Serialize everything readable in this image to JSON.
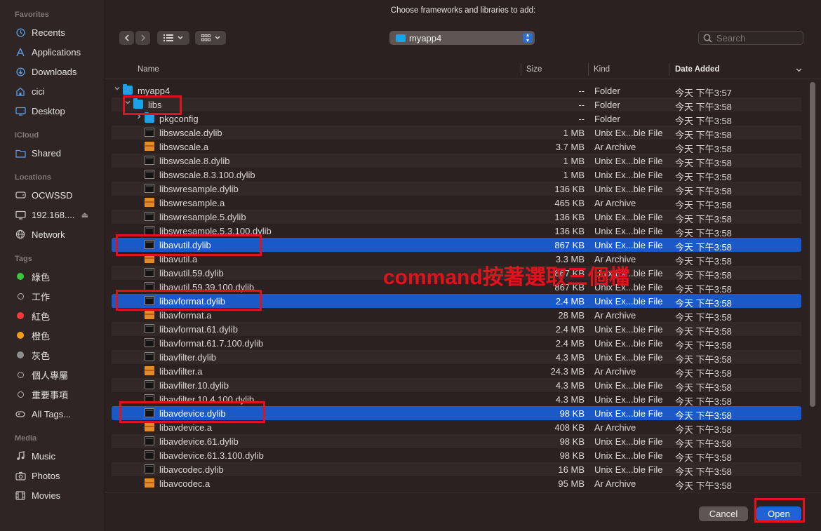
{
  "dialog_title": "Choose frameworks and libraries to add:",
  "sidebar": {
    "sections": [
      {
        "label": "Favorites",
        "items": [
          {
            "label": "Recents",
            "icon": "clock-icon"
          },
          {
            "label": "Applications",
            "icon": "applications-icon"
          },
          {
            "label": "Downloads",
            "icon": "download-icon"
          },
          {
            "label": "cici",
            "icon": "home-icon"
          },
          {
            "label": "Desktop",
            "icon": "desktop-icon"
          }
        ]
      },
      {
        "label": "iCloud",
        "items": [
          {
            "label": "Shared",
            "icon": "shared-folder-icon"
          }
        ]
      },
      {
        "label": "Locations",
        "items": [
          {
            "label": "OCWSSD",
            "icon": "drive-icon"
          },
          {
            "label": "192.168....",
            "icon": "display-icon"
          },
          {
            "label": "Network",
            "icon": "globe-icon"
          }
        ]
      },
      {
        "label": "Tags",
        "items": [
          {
            "label": "綠色",
            "color": "#3ac53f"
          },
          {
            "label": "工作",
            "color": ""
          },
          {
            "label": "紅色",
            "color": "#f23b3a"
          },
          {
            "label": "橙色",
            "color": "#f59d1b"
          },
          {
            "label": "灰色",
            "color": "#8e8e8e"
          },
          {
            "label": "個人專屬",
            "color": ""
          },
          {
            "label": "重要事項",
            "color": ""
          },
          {
            "label": "All Tags...",
            "icon": "tags-icon"
          }
        ]
      },
      {
        "label": "Media",
        "items": [
          {
            "label": "Music",
            "icon": "music-icon"
          },
          {
            "label": "Photos",
            "icon": "camera-icon"
          },
          {
            "label": "Movies",
            "icon": "film-icon"
          }
        ]
      }
    ]
  },
  "toolbar": {
    "back_icon": "chevron-left-icon",
    "forward_icon": "chevron-right-icon",
    "path_popup": "myapp4",
    "search_placeholder": "Search"
  },
  "columns": {
    "name": "Name",
    "size": "Size",
    "kind": "Kind",
    "date": "Date Added"
  },
  "files": [
    {
      "name": "myapp4",
      "size": "--",
      "kind": "Folder",
      "date": "今天 下午3:57",
      "icon": "folder",
      "level": 0,
      "disclosure": "expanded",
      "selected": false
    },
    {
      "name": "libs",
      "size": "--",
      "kind": "Folder",
      "date": "今天 下午3:58",
      "icon": "folder",
      "level": 1,
      "disclosure": "expanded",
      "selected": false
    },
    {
      "name": "pkgconfig",
      "size": "--",
      "kind": "Folder",
      "date": "今天 下午3:58",
      "icon": "folder",
      "level": 2,
      "disclosure": "collapsed",
      "selected": false
    },
    {
      "name": "libswscale.dylib",
      "size": "1 MB",
      "kind": "Unix Ex...ble File",
      "date": "今天 下午3:58",
      "icon": "exec",
      "level": 2,
      "selected": false
    },
    {
      "name": "libswscale.a",
      "size": "3.7 MB",
      "kind": "Ar Archive",
      "date": "今天 下午3:58",
      "icon": "archive",
      "level": 2,
      "selected": false
    },
    {
      "name": "libswscale.8.dylib",
      "size": "1 MB",
      "kind": "Unix Ex...ble File",
      "date": "今天 下午3:58",
      "icon": "exec",
      "level": 2,
      "selected": false
    },
    {
      "name": "libswscale.8.3.100.dylib",
      "size": "1 MB",
      "kind": "Unix Ex...ble File",
      "date": "今天 下午3:58",
      "icon": "exec",
      "level": 2,
      "selected": false
    },
    {
      "name": "libswresample.dylib",
      "size": "136 KB",
      "kind": "Unix Ex...ble File",
      "date": "今天 下午3:58",
      "icon": "exec",
      "level": 2,
      "selected": false
    },
    {
      "name": "libswresample.a",
      "size": "465 KB",
      "kind": "Ar Archive",
      "date": "今天 下午3:58",
      "icon": "archive",
      "level": 2,
      "selected": false
    },
    {
      "name": "libswresample.5.dylib",
      "size": "136 KB",
      "kind": "Unix Ex...ble File",
      "date": "今天 下午3:58",
      "icon": "exec",
      "level": 2,
      "selected": false
    },
    {
      "name": "libswresample.5.3.100.dylib",
      "size": "136 KB",
      "kind": "Unix Ex...ble File",
      "date": "今天 下午3:58",
      "icon": "exec",
      "level": 2,
      "selected": false
    },
    {
      "name": "libavutil.dylib",
      "size": "867 KB",
      "kind": "Unix Ex...ble File",
      "date": "今天 下午3:58",
      "icon": "exec",
      "level": 2,
      "selected": true
    },
    {
      "name": "libavutil.a",
      "size": "3.3 MB",
      "kind": "Ar Archive",
      "date": "今天 下午3:58",
      "icon": "archive",
      "level": 2,
      "selected": false
    },
    {
      "name": "libavutil.59.dylib",
      "size": "867 KB",
      "kind": "Unix Ex...ble File",
      "date": "今天 下午3:58",
      "icon": "exec",
      "level": 2,
      "selected": false
    },
    {
      "name": "libavutil.59.39.100.dylib",
      "size": "867 KB",
      "kind": "Unix Ex...ble File",
      "date": "今天 下午3:58",
      "icon": "exec",
      "level": 2,
      "selected": false
    },
    {
      "name": "libavformat.dylib",
      "size": "2.4 MB",
      "kind": "Unix Ex...ble File",
      "date": "今天 下午3:58",
      "icon": "exec",
      "level": 2,
      "selected": true
    },
    {
      "name": "libavformat.a",
      "size": "28 MB",
      "kind": "Ar Archive",
      "date": "今天 下午3:58",
      "icon": "archive",
      "level": 2,
      "selected": false
    },
    {
      "name": "libavformat.61.dylib",
      "size": "2.4 MB",
      "kind": "Unix Ex...ble File",
      "date": "今天 下午3:58",
      "icon": "exec",
      "level": 2,
      "selected": false
    },
    {
      "name": "libavformat.61.7.100.dylib",
      "size": "2.4 MB",
      "kind": "Unix Ex...ble File",
      "date": "今天 下午3:58",
      "icon": "exec",
      "level": 2,
      "selected": false
    },
    {
      "name": "libavfilter.dylib",
      "size": "4.3 MB",
      "kind": "Unix Ex...ble File",
      "date": "今天 下午3:58",
      "icon": "exec",
      "level": 2,
      "selected": false
    },
    {
      "name": "libavfilter.a",
      "size": "24.3 MB",
      "kind": "Ar Archive",
      "date": "今天 下午3:58",
      "icon": "archive",
      "level": 2,
      "selected": false
    },
    {
      "name": "libavfilter.10.dylib",
      "size": "4.3 MB",
      "kind": "Unix Ex...ble File",
      "date": "今天 下午3:58",
      "icon": "exec",
      "level": 2,
      "selected": false
    },
    {
      "name": "libavfilter.10.4.100.dylib",
      "size": "4.3 MB",
      "kind": "Unix Ex...ble File",
      "date": "今天 下午3:58",
      "icon": "exec",
      "level": 2,
      "selected": false
    },
    {
      "name": "libavdevice.dylib",
      "size": "98 KB",
      "kind": "Unix Ex...ble File",
      "date": "今天 下午3:58",
      "icon": "exec",
      "level": 2,
      "selected": true
    },
    {
      "name": "libavdevice.a",
      "size": "408 KB",
      "kind": "Ar Archive",
      "date": "今天 下午3:58",
      "icon": "archive",
      "level": 2,
      "selected": false
    },
    {
      "name": "libavdevice.61.dylib",
      "size": "98 KB",
      "kind": "Unix Ex...ble File",
      "date": "今天 下午3:58",
      "icon": "exec",
      "level": 2,
      "selected": false
    },
    {
      "name": "libavdevice.61.3.100.dylib",
      "size": "98 KB",
      "kind": "Unix Ex...ble File",
      "date": "今天 下午3:58",
      "icon": "exec",
      "level": 2,
      "selected": false
    },
    {
      "name": "libavcodec.dylib",
      "size": "16 MB",
      "kind": "Unix Ex...ble File",
      "date": "今天 下午3:58",
      "icon": "exec",
      "level": 2,
      "selected": false
    },
    {
      "name": "libavcodec.a",
      "size": "95 MB",
      "kind": "Ar Archive",
      "date": "今天 下午3:58",
      "icon": "archive",
      "level": 2,
      "selected": false
    }
  ],
  "buttons": {
    "cancel": "Cancel",
    "open": "Open"
  },
  "annotation": {
    "text": "command按著選取三個檔",
    "color": "#e0121c"
  },
  "colors": {
    "selection": "#1a5ac8",
    "accent": "#2c6fd1"
  }
}
